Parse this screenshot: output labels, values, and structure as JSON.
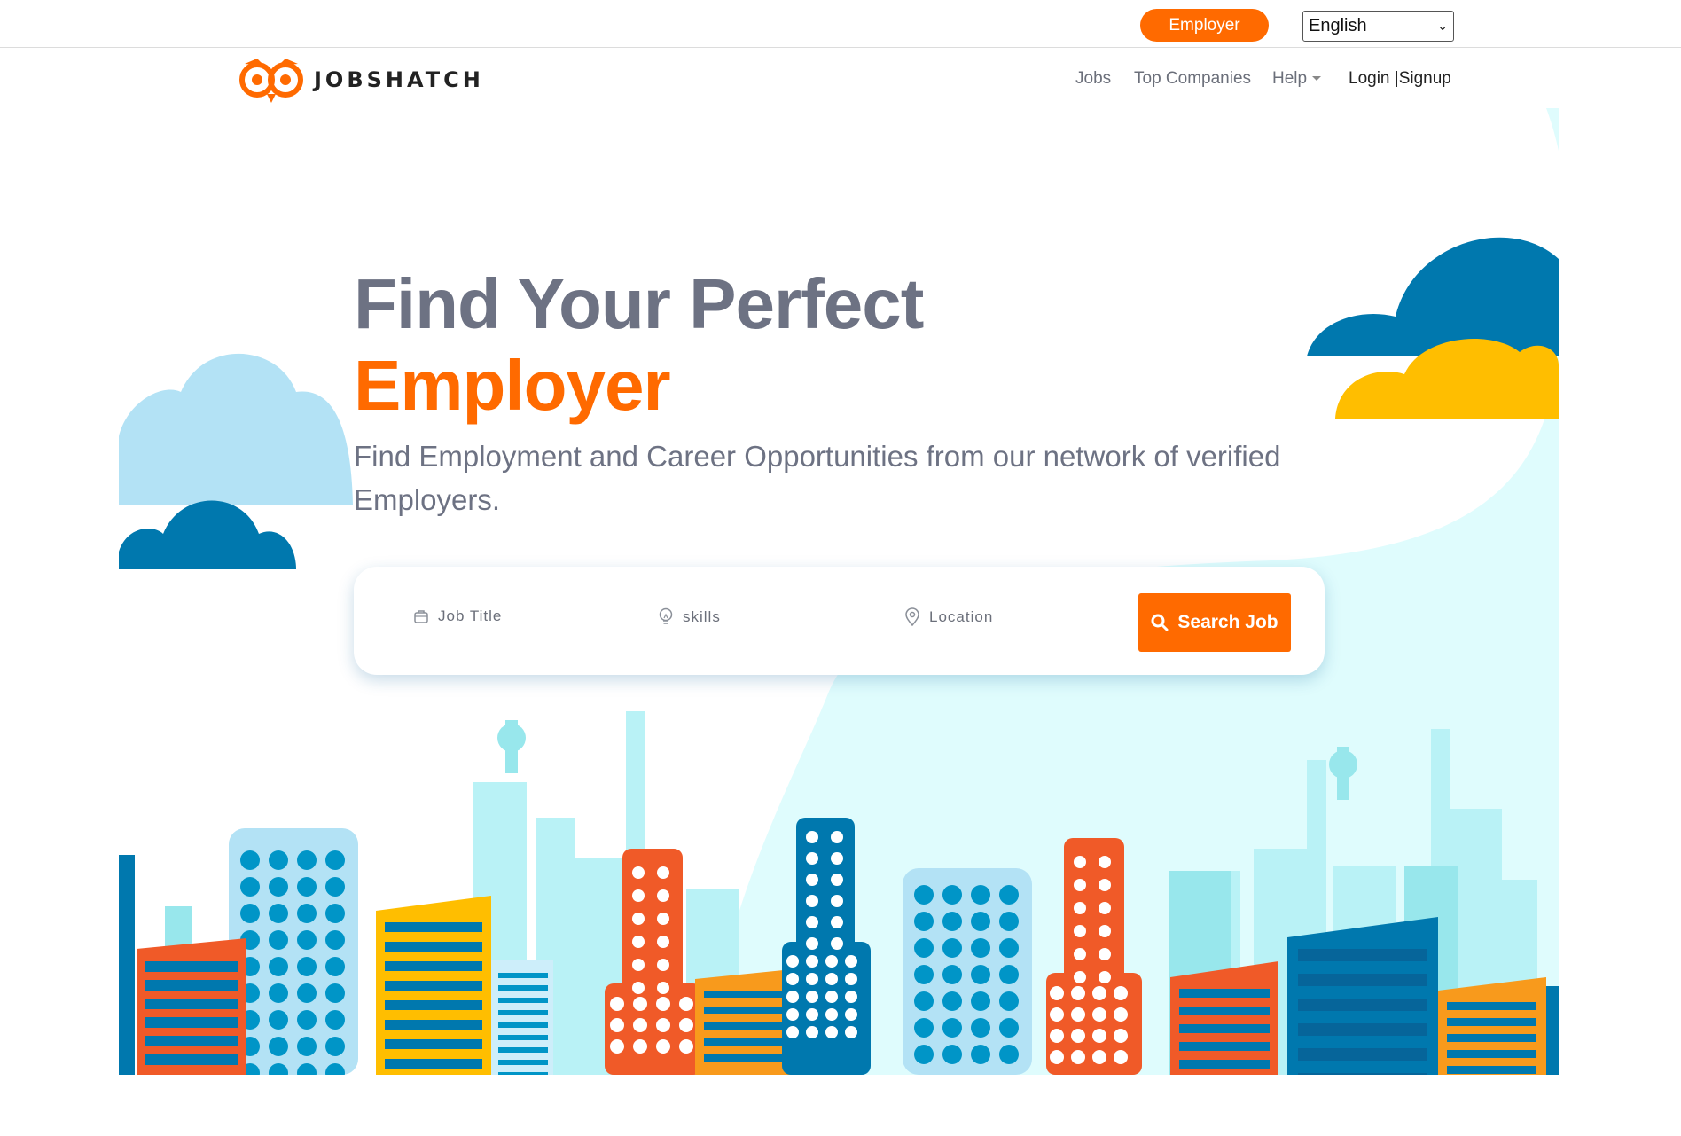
{
  "topbar": {
    "employer_label": "Employer",
    "language": "English"
  },
  "nav": {
    "brand": "JOBSHATCH",
    "links": [
      {
        "label": "Jobs"
      },
      {
        "label": "Top Companies"
      },
      {
        "label": "Help"
      },
      {
        "label": "Login |Signup"
      }
    ]
  },
  "hero": {
    "title_line1": "Find Your Perfect",
    "title_line2": "Employer",
    "subtitle": "Find Employment and Career Opportunities from our network of verified Employers."
  },
  "search": {
    "job_title_placeholder": "Job Title",
    "skills_placeholder": "skills",
    "location_placeholder": "Location",
    "button_label": "Search Job"
  },
  "colors": {
    "accent": "#ff6a00",
    "navy": "#0078ae",
    "sky": "#b3e2f5",
    "mint": "#dffcfd"
  }
}
